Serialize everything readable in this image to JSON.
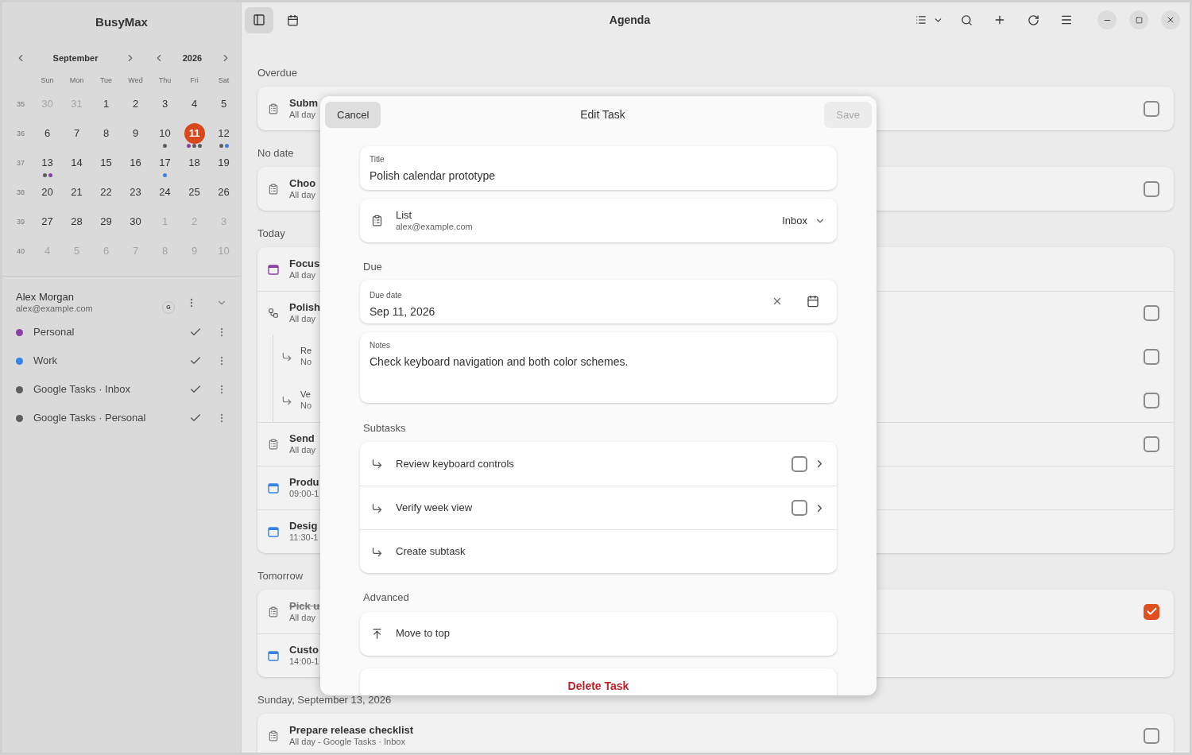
{
  "app_title": "BusyMax",
  "toolbar": {
    "sidebar_toggle_selected": true,
    "title": "Agenda"
  },
  "calendar": {
    "month": "September",
    "year": "2026",
    "weekdays": [
      "Sun",
      "Mon",
      "Tue",
      "Wed",
      "Thu",
      "Fri",
      "Sat"
    ],
    "weeks": [
      {
        "number": "35",
        "days": [
          {
            "label": "30",
            "muted": true,
            "selected": false
          },
          {
            "label": "31",
            "muted": true,
            "selected": false
          },
          {
            "label": "1",
            "muted": false,
            "selected": false
          },
          {
            "label": "2",
            "muted": false,
            "selected": false
          },
          {
            "label": "3",
            "muted": false,
            "selected": false
          },
          {
            "label": "4",
            "muted": false,
            "selected": false
          },
          {
            "label": "5",
            "muted": false,
            "selected": false
          }
        ]
      },
      {
        "number": "36",
        "days": [
          {
            "label": "6",
            "muted": false,
            "selected": false
          },
          {
            "label": "7",
            "muted": false,
            "selected": false
          },
          {
            "label": "8",
            "muted": false,
            "selected": false
          },
          {
            "label": "9",
            "muted": false,
            "selected": false
          },
          {
            "label": "10",
            "muted": false,
            "selected": false,
            "dots": [
              {
                "color": "#5e5e5e"
              }
            ]
          },
          {
            "label": "11",
            "muted": false,
            "selected": true,
            "dots": [
              {
                "color": "#8e3fa6"
              },
              {
                "color": "#5e5e5e"
              },
              {
                "color": "#5e5e5e"
              }
            ]
          },
          {
            "label": "12",
            "muted": false,
            "selected": false,
            "dots": [
              {
                "color": "#5e5e5e"
              },
              {
                "color": "#3584e4"
              }
            ]
          }
        ]
      },
      {
        "number": "37",
        "days": [
          {
            "label": "13",
            "muted": false,
            "selected": false,
            "dots": [
              {
                "color": "#5e5e5e"
              },
              {
                "color": "#8e3fa6"
              }
            ]
          },
          {
            "label": "14",
            "muted": false,
            "selected": false
          },
          {
            "label": "15",
            "muted": false,
            "selected": false
          },
          {
            "label": "16",
            "muted": false,
            "selected": false
          },
          {
            "label": "17",
            "muted": false,
            "selected": false,
            "dots": [
              {
                "color": "#3584e4"
              }
            ]
          },
          {
            "label": "18",
            "muted": false,
            "selected": false
          },
          {
            "label": "19",
            "muted": false,
            "selected": false
          }
        ]
      },
      {
        "number": "38",
        "days": [
          {
            "label": "20",
            "muted": false,
            "selected": false
          },
          {
            "label": "21",
            "muted": false,
            "selected": false
          },
          {
            "label": "22",
            "muted": false,
            "selected": false
          },
          {
            "label": "23",
            "muted": false,
            "selected": false
          },
          {
            "label": "24",
            "muted": false,
            "selected": false
          },
          {
            "label": "25",
            "muted": false,
            "selected": false
          },
          {
            "label": "26",
            "muted": false,
            "selected": false
          }
        ]
      },
      {
        "number": "39",
        "days": [
          {
            "label": "27",
            "muted": false,
            "selected": false
          },
          {
            "label": "28",
            "muted": false,
            "selected": false
          },
          {
            "label": "29",
            "muted": false,
            "selected": false
          },
          {
            "label": "30",
            "muted": false,
            "selected": false
          },
          {
            "label": "1",
            "muted": true,
            "selected": false
          },
          {
            "label": "2",
            "muted": true,
            "selected": false
          },
          {
            "label": "3",
            "muted": true,
            "selected": false
          }
        ]
      },
      {
        "number": "40",
        "days": [
          {
            "label": "4",
            "muted": true,
            "selected": false
          },
          {
            "label": "5",
            "muted": true,
            "selected": false
          },
          {
            "label": "6",
            "muted": true,
            "selected": false
          },
          {
            "label": "7",
            "muted": true,
            "selected": false
          },
          {
            "label": "8",
            "muted": true,
            "selected": false
          },
          {
            "label": "9",
            "muted": true,
            "selected": false
          },
          {
            "label": "10",
            "muted": true,
            "selected": false
          }
        ]
      }
    ]
  },
  "account": {
    "name": "Alex Morgan",
    "email": "alex@example.com",
    "badge": "G",
    "calendars": [
      {
        "name": "Personal",
        "color": "#8e3fa6",
        "checked": true
      },
      {
        "name": "Work",
        "color": "#3584e4",
        "checked": true
      },
      {
        "name": "Google Tasks · Inbox",
        "color": "#5e5e5e",
        "checked": true
      },
      {
        "name": "Google Tasks · Personal",
        "color": "#5e5e5e",
        "checked": true
      }
    ]
  },
  "agenda": [
    {
      "heading": "Overdue",
      "items": [
        {
          "kind": "task",
          "title": "Subm",
          "meta": "All day",
          "checked": false
        }
      ]
    },
    {
      "heading": "No date",
      "items": [
        {
          "kind": "task",
          "title": "Choo",
          "meta": "All day",
          "checked": false
        }
      ]
    },
    {
      "heading": "Today",
      "items": [
        {
          "kind": "event",
          "color": "#8e3fa6",
          "title": "Focus",
          "meta": "All day"
        },
        {
          "kind": "parent",
          "title": "Polish",
          "meta": "All day",
          "checked": false,
          "children": [
            {
              "kind": "subtask",
              "title": "Re",
              "meta": "No",
              "checked": false
            },
            {
              "kind": "subtask",
              "title": "Ve",
              "meta": "No",
              "checked": false
            }
          ]
        },
        {
          "kind": "task",
          "title": "Send",
          "meta": "All day",
          "checked": false
        },
        {
          "kind": "event",
          "color": "#3584e4",
          "title": "Produ",
          "meta": "09:00-1"
        },
        {
          "kind": "event",
          "color": "#3584e4",
          "title": "Desig",
          "meta": "11:30-1"
        }
      ]
    },
    {
      "heading": "Tomorrow",
      "items": [
        {
          "kind": "task",
          "title": "Pick u",
          "meta": "All day",
          "checked": true
        },
        {
          "kind": "event",
          "color": "#3584e4",
          "title": "Custo",
          "meta": "14:00-1"
        }
      ]
    },
    {
      "heading": "Sunday, September 13, 2026",
      "items": [
        {
          "kind": "task",
          "title": "Prepare release checklist",
          "meta": "All day - Google Tasks · Inbox",
          "checked": false
        }
      ]
    }
  ],
  "dialog": {
    "title": "Edit Task",
    "cancel": "Cancel",
    "save": {
      "label": "Save",
      "disabled": true
    },
    "title_field": {
      "label": "Title",
      "value": "Polish calendar prototype"
    },
    "list_field": {
      "label": "List",
      "account": "alex@example.com",
      "value": "Inbox"
    },
    "due_heading": "Due",
    "due_field": {
      "label": "Due date",
      "value": "Sep 11, 2026"
    },
    "notes_field": {
      "label": "Notes",
      "value": "Check keyboard navigation and both color schemes."
    },
    "subtasks_heading": "Subtasks",
    "subtasks": [
      {
        "kind": "subtask",
        "title": "Review keyboard controls",
        "checked": false
      },
      {
        "kind": "subtask",
        "title": "Verify week view",
        "checked": false
      },
      {
        "kind": "create",
        "title": "Create subtask"
      }
    ],
    "advanced_heading": "Advanced",
    "move_to_top": "Move to top",
    "delete": "Delete Task"
  }
}
